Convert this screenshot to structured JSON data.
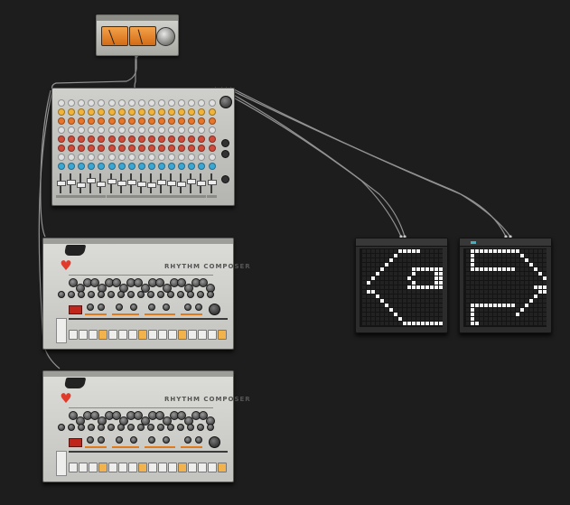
{
  "workspace": {
    "background": "#1d1d1d",
    "cable_color": "#aaaaaa"
  },
  "master_unit": {
    "meters": [
      "left-vu-meter",
      "right-vu-meter"
    ],
    "meter_color": "#e9882f",
    "needle_levels": [
      0.35,
      0.4
    ]
  },
  "mixer": {
    "channel_count": 16,
    "knob_colors": [
      "#e0e0e0",
      "#f0b43a",
      "#e8762a",
      "#e0e0e0",
      "#d04b3a",
      "#d04b3a",
      "#e0e0e0",
      "#3aa7d4"
    ],
    "fader_levels": [
      0.55,
      0.6,
      0.45,
      0.7,
      0.5,
      0.65,
      0.55,
      0.6,
      0.5,
      0.45,
      0.6,
      0.55,
      0.5,
      0.65,
      0.55,
      0.6
    ]
  },
  "drum_machines": [
    {
      "brand_text": "RHYTHM COMPOSER",
      "active_steps": [
        3,
        7,
        11,
        15
      ]
    },
    {
      "brand_text": "RHYTHM COMPOSER",
      "active_steps": [
        3,
        7,
        11,
        15
      ]
    }
  ],
  "led_grids": [
    {
      "icon": "left-arrow-pattern",
      "on_cells": [
        [
          11,
          3
        ],
        [
          12,
          3
        ],
        [
          13,
          3
        ],
        [
          14,
          3
        ],
        [
          15,
          3
        ],
        [
          10,
          4
        ],
        [
          9,
          5
        ],
        [
          8,
          6
        ],
        [
          7,
          7
        ],
        [
          14,
          7
        ],
        [
          15,
          7
        ],
        [
          16,
          7
        ],
        [
          17,
          7
        ],
        [
          18,
          7
        ],
        [
          19,
          7
        ],
        [
          20,
          7
        ],
        [
          6,
          8
        ],
        [
          14,
          8
        ],
        [
          5,
          9
        ],
        [
          4,
          10
        ],
        [
          13,
          11
        ],
        [
          14,
          11
        ],
        [
          15,
          11
        ],
        [
          16,
          11
        ],
        [
          17,
          11
        ],
        [
          18,
          11
        ],
        [
          19,
          11
        ],
        [
          20,
          11
        ],
        [
          5,
          12
        ],
        [
          4,
          12
        ],
        [
          6,
          13
        ],
        [
          7,
          14
        ],
        [
          8,
          15
        ],
        [
          9,
          16
        ],
        [
          10,
          17
        ],
        [
          11,
          18
        ],
        [
          12,
          19
        ],
        [
          13,
          19
        ],
        [
          14,
          19
        ],
        [
          15,
          19
        ],
        [
          16,
          19
        ],
        [
          17,
          19
        ],
        [
          18,
          19
        ],
        [
          19,
          19
        ],
        [
          20,
          19
        ],
        [
          13,
          9
        ],
        [
          14,
          10
        ],
        [
          19,
          8
        ],
        [
          19,
          9
        ],
        [
          19,
          10
        ],
        [
          20,
          8
        ],
        [
          20,
          9
        ],
        [
          20,
          10
        ]
      ]
    },
    {
      "icon": "right-arrow-pattern",
      "on_cells": [
        [
          4,
          3
        ],
        [
          5,
          3
        ],
        [
          6,
          3
        ],
        [
          7,
          3
        ],
        [
          8,
          3
        ],
        [
          9,
          3
        ],
        [
          10,
          3
        ],
        [
          11,
          3
        ],
        [
          12,
          3
        ],
        [
          13,
          3
        ],
        [
          14,
          3
        ],
        [
          15,
          4
        ],
        [
          16,
          5
        ],
        [
          17,
          6
        ],
        [
          18,
          7
        ],
        [
          19,
          8
        ],
        [
          20,
          9
        ],
        [
          21,
          10
        ],
        [
          20,
          11
        ],
        [
          19,
          12
        ],
        [
          18,
          13
        ],
        [
          17,
          14
        ],
        [
          16,
          15
        ],
        [
          15,
          16
        ],
        [
          14,
          17
        ],
        [
          4,
          4
        ],
        [
          4,
          5
        ],
        [
          4,
          6
        ],
        [
          4,
          7
        ],
        [
          5,
          7
        ],
        [
          6,
          7
        ],
        [
          7,
          7
        ],
        [
          8,
          7
        ],
        [
          9,
          7
        ],
        [
          10,
          7
        ],
        [
          11,
          7
        ],
        [
          12,
          7
        ],
        [
          13,
          7
        ],
        [
          5,
          15
        ],
        [
          6,
          15
        ],
        [
          7,
          15
        ],
        [
          8,
          15
        ],
        [
          9,
          15
        ],
        [
          10,
          15
        ],
        [
          11,
          15
        ],
        [
          12,
          15
        ],
        [
          13,
          15
        ],
        [
          4,
          15
        ],
        [
          4,
          16
        ],
        [
          4,
          17
        ],
        [
          4,
          18
        ],
        [
          4,
          19
        ],
        [
          5,
          19
        ],
        [
          20,
          12
        ],
        [
          19,
          11
        ],
        [
          18,
          11
        ],
        [
          21,
          11
        ]
      ]
    }
  ]
}
